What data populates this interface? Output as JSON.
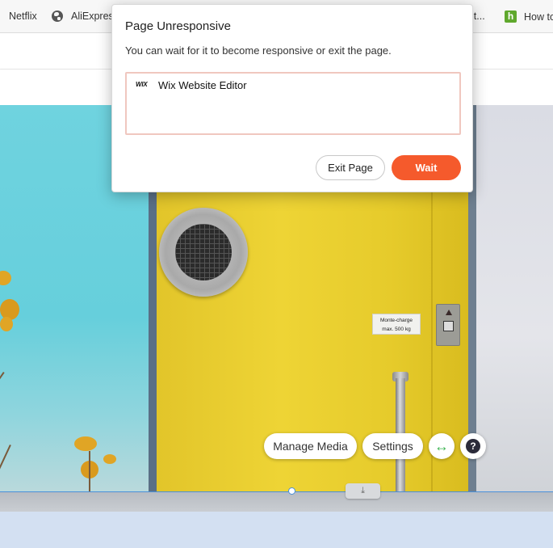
{
  "bookmarks": {
    "items": [
      {
        "label": "Netflix"
      },
      {
        "label": "AliExpress"
      },
      {
        "label": "it..."
      },
      {
        "label": "How to"
      }
    ],
    "how_icon_letter": "h"
  },
  "canvas": {
    "plate_line1": "Monte-charge",
    "plate_line2": "max.  500  kg"
  },
  "editor_controls": {
    "manage_media_label": "Manage Media",
    "settings_label": "Settings",
    "stretch_icon": "↔",
    "help_icon": "?",
    "drag_handle_icon": "⤓"
  },
  "dialog": {
    "title": "Page Unresponsive",
    "message": "You can wait for it to become responsive or exit the page.",
    "pages": [
      {
        "logo": "WIX",
        "name": "Wix Website Editor"
      }
    ],
    "exit_label": "Exit Page",
    "wait_label": "Wait",
    "colors": {
      "wait": "#f55a2c",
      "list_border": "#f0c7bf"
    }
  }
}
